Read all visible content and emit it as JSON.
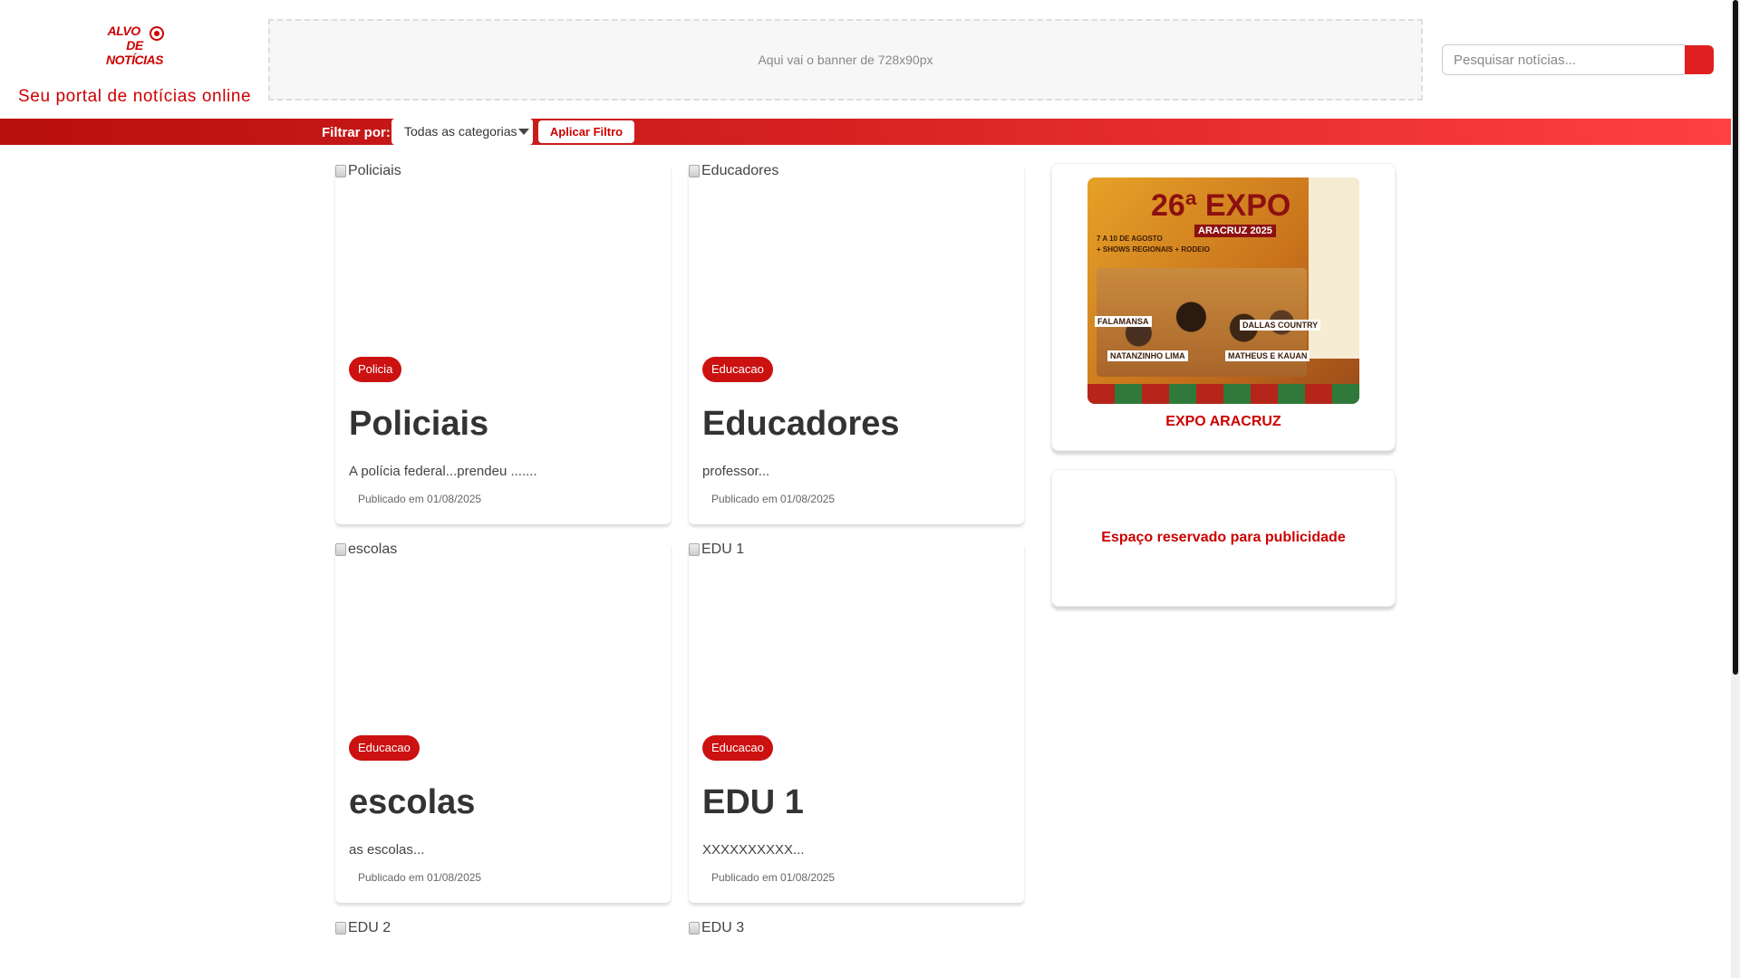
{
  "header": {
    "logo_line1": "ALVO",
    "logo_line2": "DE NOTÍCIAS",
    "tagline": "Seu portal de notícias online",
    "banner_text": "Aqui vai o banner de 728x90px",
    "search_placeholder": "Pesquisar notícias..."
  },
  "filter": {
    "label": "Filtrar por:",
    "selected": "Todas as categorias",
    "button": "Aplicar Filtro"
  },
  "articles": [
    {
      "image_alt": "Policiais",
      "category": "Policia",
      "title": "Policiais",
      "excerpt": "A polícia federal...prendeu .......",
      "date": "Publicado em 01/08/2025"
    },
    {
      "image_alt": "Educadores",
      "category": "Educacao",
      "title": "Educadores",
      "excerpt": "professor...",
      "date": "Publicado em 01/08/2025"
    },
    {
      "image_alt": "escolas",
      "category": "Educacao",
      "title": "escolas",
      "excerpt": "as escolas...",
      "date": "Publicado em 01/08/2025"
    },
    {
      "image_alt": "EDU 1",
      "category": "Educacao",
      "title": "EDU 1",
      "excerpt": "XXXXXXXXXX...",
      "date": "Publicado em 01/08/2025"
    },
    {
      "image_alt": "EDU 2"
    },
    {
      "image_alt": "EDU 3"
    }
  ],
  "sidebar": {
    "expo": {
      "poster_edition": "26ª EXPO",
      "poster_city": "ARACRUZ 2025",
      "poster_dates": "7 A 10 DE AGOSTO",
      "poster_highlights": "+ SHOWS REGIONAIS + RODEIO",
      "artists": [
        "FALAMANSA",
        "DALLAS COUNTRY",
        "NATANZINHO LIMA",
        "MATHEUS E KAUAN"
      ],
      "caption": "EXPO ARACRUZ"
    },
    "ad_text": "Espaço reservado para publicidade"
  },
  "colors": {
    "brand": "#cc0000",
    "filter_bar_start": "#b80f0f",
    "filter_bar_end": "#ff4040"
  }
}
